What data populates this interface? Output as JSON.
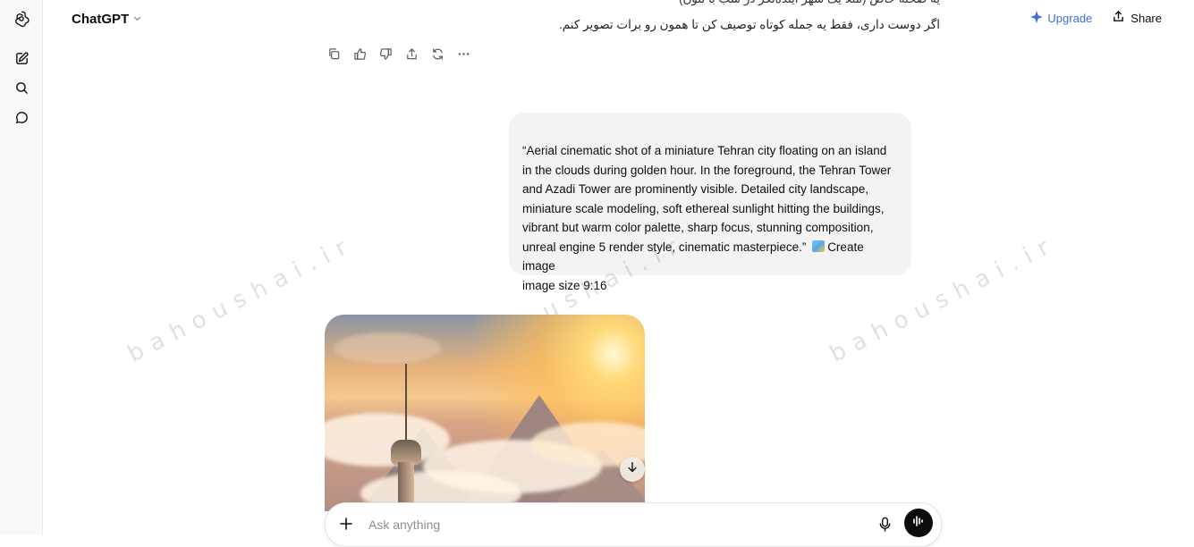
{
  "app": {
    "name": "ChatGPT",
    "model_chevron": "⌄"
  },
  "header": {
    "upgrade_label": "Upgrade",
    "share_label": "Share"
  },
  "sidebar": {
    "icons": [
      "chatgpt-logo-icon",
      "new-chat-icon",
      "search-icon",
      "chats-icon"
    ]
  },
  "previous_message": {
    "clipped_line": "یه صحنه خاص (مثلا یک شهر آینده‌نگر در شب با نئون)",
    "line": "اگر دوست داری، فقط یه جمله کوتاه توصیف کن تا همون رو برات تصویر کنم."
  },
  "message_actions": [
    "copy-icon",
    "thumbs-up-icon",
    "thumbs-down-icon",
    "share-icon",
    "regenerate-icon",
    "more-icon"
  ],
  "user_message": {
    "text": "“Aerial cinematic shot of a miniature Tehran city floating on an island in the clouds during golden hour. In the foreground, the Tehran Tower and Azadi Tower are prominently visible. Detailed city landscape, miniature scale modeling, soft ethereal sunlight hitting the buildings, vibrant but warm color palette, sharp focus, stunning composition, unreal engine 5 render style, cinematic masterpiece.”",
    "tool_label": "Create image",
    "size_note": "image size 9:16"
  },
  "watermark": "bahoushai.ir",
  "composer": {
    "placeholder": "Ask anything"
  },
  "colors": {
    "accent": "#3c6fd6",
    "bubble": "#f3f3f3",
    "sidebar": "#f9f9f9"
  }
}
